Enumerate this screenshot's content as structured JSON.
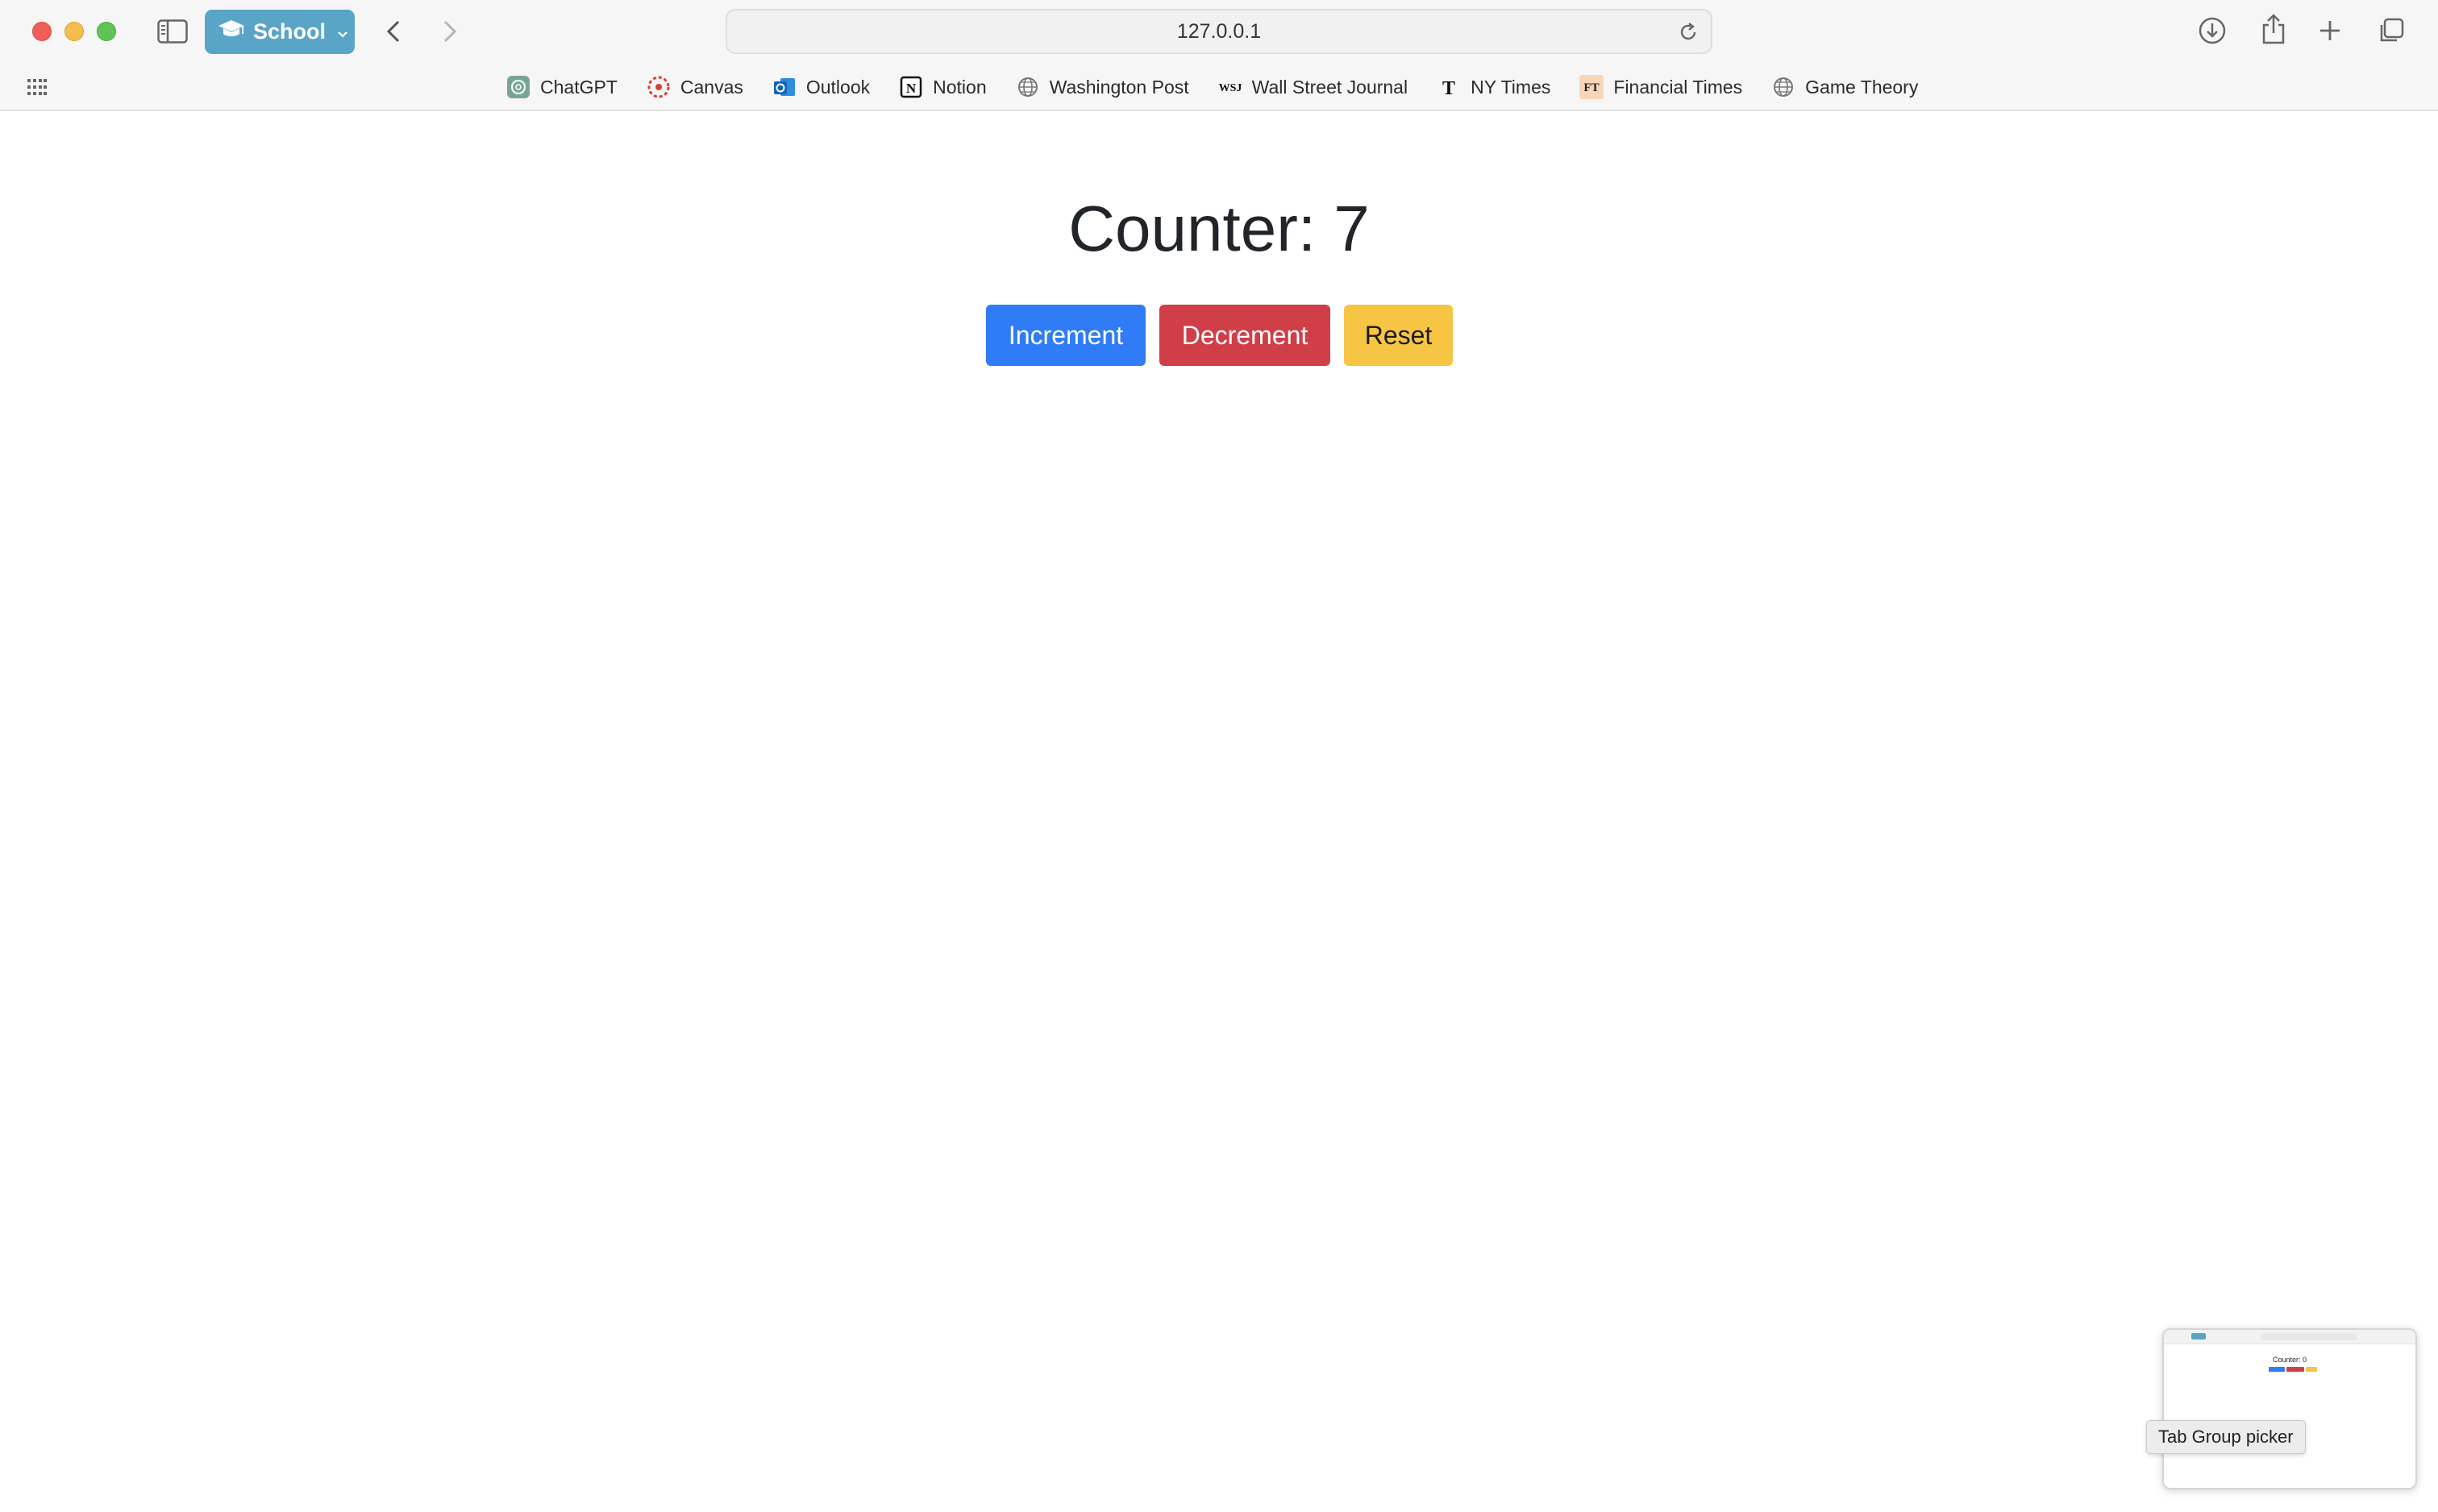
{
  "browser": {
    "tab_group": "School",
    "address": "127.0.0.1",
    "favorites": [
      {
        "label": "ChatGPT",
        "icon": "chatgpt-icon"
      },
      {
        "label": "Canvas",
        "icon": "canvas-icon"
      },
      {
        "label": "Outlook",
        "icon": "outlook-icon"
      },
      {
        "label": "Notion",
        "icon": "notion-icon"
      },
      {
        "label": "Washington Post",
        "icon": "globe-icon"
      },
      {
        "label": "Wall Street Journal",
        "icon": "wsj-icon"
      },
      {
        "label": "NY Times",
        "icon": "nyt-icon"
      },
      {
        "label": "Financial Times",
        "icon": "ft-icon"
      },
      {
        "label": "Game Theory",
        "icon": "globe-icon"
      }
    ],
    "tooltip": "Tab Group picker",
    "preview_title": "Counter: 0"
  },
  "page": {
    "heading": "Counter: 7",
    "buttons": {
      "increment": "Increment",
      "decrement": "Decrement",
      "reset": "Reset"
    }
  },
  "colors": {
    "primary": "#2f7cf6",
    "danger": "#d03e48",
    "warning": "#f7c544",
    "tab_group": "#5aa5c7"
  }
}
